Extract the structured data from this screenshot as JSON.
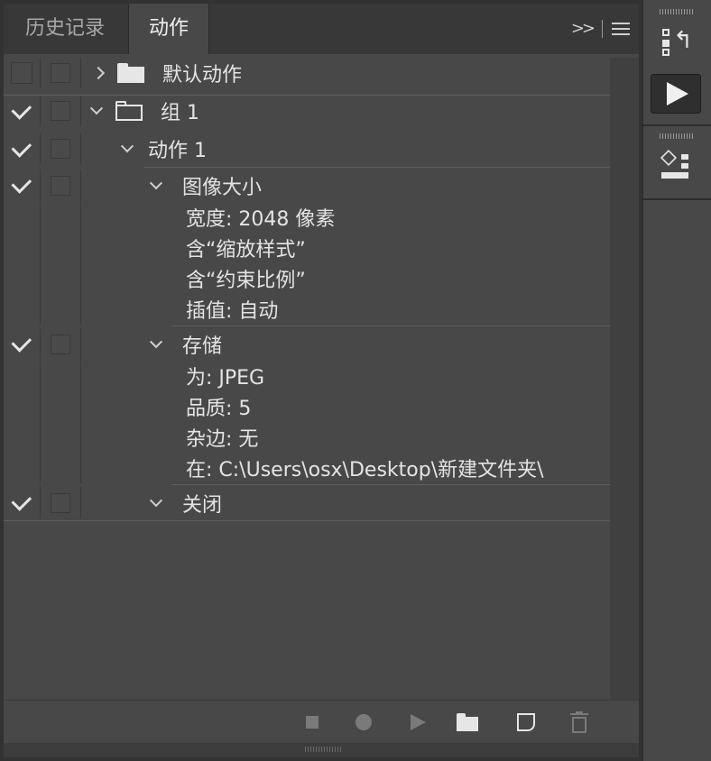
{
  "tabs": [
    {
      "label": "历史记录",
      "active": false
    },
    {
      "label": "动作",
      "active": true
    }
  ],
  "tree": [
    {
      "label": "默认动作",
      "checked": false
    },
    {
      "label": "组 1",
      "checked": true
    },
    {
      "label": "动作 1",
      "checked": true
    },
    {
      "label": "图像大小",
      "checked": true,
      "params": [
        "宽度: 2048 像素",
        "含“缩放样式”",
        "含“约束比例”",
        "插值: 自动"
      ]
    },
    {
      "label": "存储",
      "checked": true,
      "params": [
        "为: JPEG",
        "品质: 5",
        "杂边: 无",
        "在: C:\\Users\\osx\\Desktop\\新建文件夹\\"
      ]
    },
    {
      "label": "关闭",
      "checked": true
    }
  ],
  "colors": {
    "panel_bg": "#484848",
    "tabbar_bg": "#383838",
    "text": "#e4e4e4",
    "disabled_icon": "#7a7a7a"
  }
}
